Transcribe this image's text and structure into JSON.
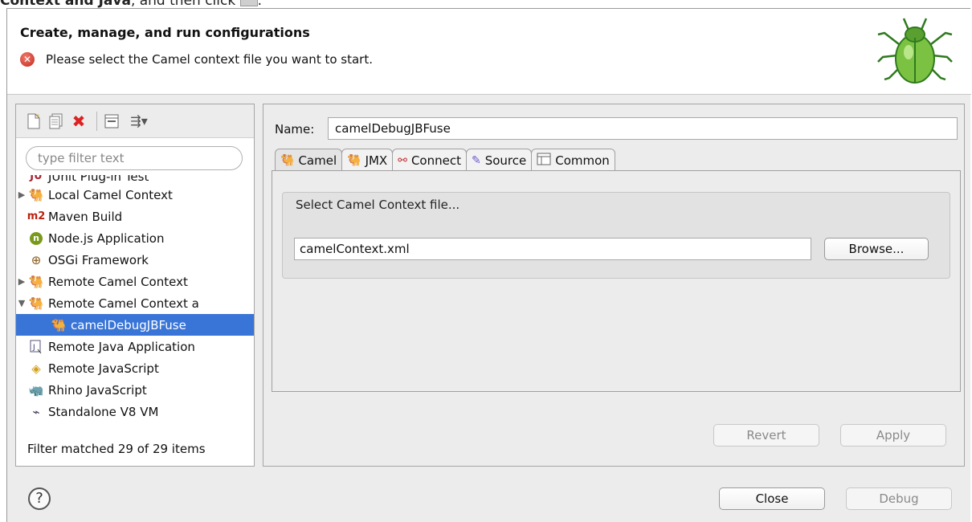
{
  "caption": {
    "bold_text": "Context and Java",
    "rest_text": ", and then click",
    "trail_text": "."
  },
  "header": {
    "title": "Create, manage, and run configurations",
    "message": "Please select the Camel context file you want to start."
  },
  "left": {
    "toolbar_icons": [
      "new-config-icon",
      "duplicate-icon",
      "delete-icon",
      "collapse-all-icon",
      "filter-icon"
    ],
    "filter_placeholder": "type filter text",
    "tree": [
      {
        "label": "JUnit Plug-in Test",
        "icon": "junit-icon"
      },
      {
        "label": "Local Camel Context",
        "icon": "camel-icon"
      },
      {
        "label": "Maven Build",
        "icon": "maven-icon"
      },
      {
        "label": "Node.js Application",
        "icon": "nodejs-icon"
      },
      {
        "label": "OSGi Framework",
        "icon": "osgi-icon"
      },
      {
        "label": "Remote Camel Context",
        "icon": "camel-icon"
      },
      {
        "label": "Remote Camel Context a",
        "icon": "camel-icon"
      },
      {
        "label": "camelDebugJBFuse",
        "icon": "camel-icon"
      },
      {
        "label": "Remote Java Application",
        "icon": "java-icon"
      },
      {
        "label": "Remote JavaScript",
        "icon": "javascript-icon"
      },
      {
        "label": "Rhino JavaScript",
        "icon": "rhino-icon"
      },
      {
        "label": "Standalone V8 VM",
        "icon": "v8-icon"
      }
    ],
    "status": "Filter matched 29 of 29 items"
  },
  "right": {
    "name_label": "Name:",
    "name_value": "camelDebugJBFuse",
    "tabs": [
      {
        "label": "Camel",
        "icon": "camel-icon"
      },
      {
        "label": "JMX",
        "icon": "camel-icon"
      },
      {
        "label": "Connect",
        "icon": "connect-icon"
      },
      {
        "label": "Source",
        "icon": "source-icon"
      },
      {
        "label": "Common",
        "icon": "common-icon"
      }
    ],
    "group_title": "Select Camel Context file...",
    "file_value": "camelContext.xml",
    "browse_label": "Browse...",
    "revert_label": "Revert",
    "apply_label": "Apply"
  },
  "footer": {
    "help_symbol": "?",
    "close_label": "Close",
    "debug_label": "Debug"
  },
  "colors": {
    "selection": "#3875d7",
    "error": "#c2281c"
  }
}
